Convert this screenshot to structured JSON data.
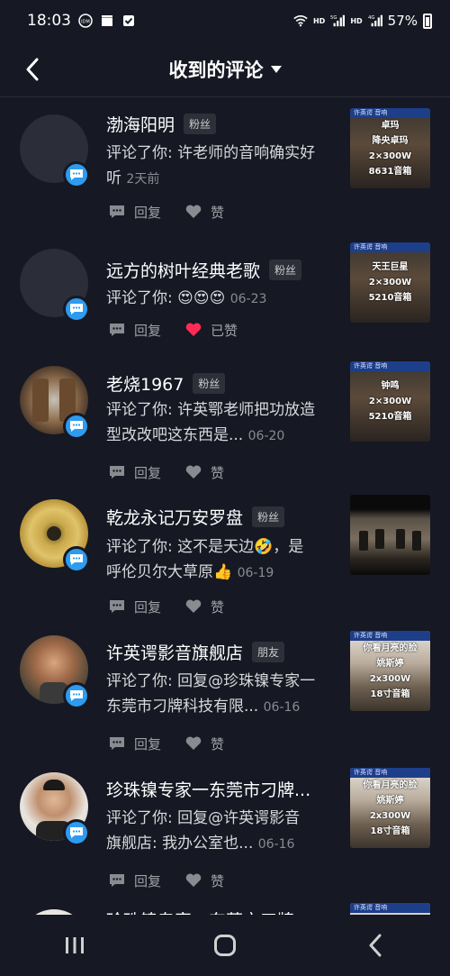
{
  "status": {
    "time": "18:03",
    "battery": "57%",
    "hd1": "HD",
    "net1": "5G",
    "hd2": "HD",
    "net2": "4G"
  },
  "header": {
    "title": "收到的评论"
  },
  "actions": {
    "reply_label": "回复",
    "like_label": "赞",
    "liked_label": "已赞"
  },
  "items": [
    {
      "name": "渤海阳明",
      "tag": "粉丝",
      "comment_line1": "评论了你: 许老师的音响确实好",
      "comment_line2": "听",
      "time": "2天前",
      "thumb_lines": [
        "卓玛",
        "降央卓玛",
        "2×300W",
        "8631音箱"
      ],
      "liked": false
    },
    {
      "name": "远方的树叶经典老歌",
      "tag": "粉丝",
      "comment_line1": "评论了你: 😍😍😍",
      "time": "06-23",
      "thumb_lines": [
        "许英谔 音响",
        "天王巨星",
        "2×300W",
        "5210音箱"
      ],
      "liked": true
    },
    {
      "name": "老烧1967",
      "tag": "粉丝",
      "comment_line1": "评论了你: 许英鄂老师把功放造",
      "comment_line2": "型改改吧这东西是...",
      "time": "06-20",
      "thumb_lines": [
        "许英谔 音响",
        "钟鸣",
        "2×300W",
        "5210音箱"
      ],
      "liked": false
    },
    {
      "name": "乾龙永记万安罗盘",
      "tag": "粉丝",
      "comment_line1": "评论了你: 这不是天边🤣，是",
      "comment_line2": "呼伦贝尔大草原👍",
      "time": "06-19",
      "thumb_lines": [],
      "liked": false
    },
    {
      "name": "许英谔影音旗舰店",
      "tag": "朋友",
      "comment_line1": "评论了你: 回复@珍珠镍专家一",
      "comment_line2": "东莞市刁牌科技有限...",
      "time": "06-16",
      "thumb_lines": [
        "你看月亮的脸",
        "姚斯婷",
        "2x300W",
        "18寸音箱"
      ],
      "liked": false
    },
    {
      "name": "珍珠镍专家一东莞市刁牌...",
      "tag": "",
      "comment_line1": "评论了你: 回复@许英谔影音",
      "comment_line2": "旗舰店: 我办公室也...",
      "time": "06-16",
      "thumb_lines": [
        "你看月亮的脸",
        "姚斯婷",
        "2x300W",
        "18寸音箱"
      ],
      "liked": false
    },
    {
      "name": "珍珠镍专家一东莞市刁牌",
      "tag": "",
      "comment_line1": "",
      "time": "",
      "thumb_lines": [],
      "liked": false
    }
  ],
  "colors": {
    "background": "#161823",
    "badge": "#2d9bf0",
    "liked_heart": "#fe2c55"
  }
}
